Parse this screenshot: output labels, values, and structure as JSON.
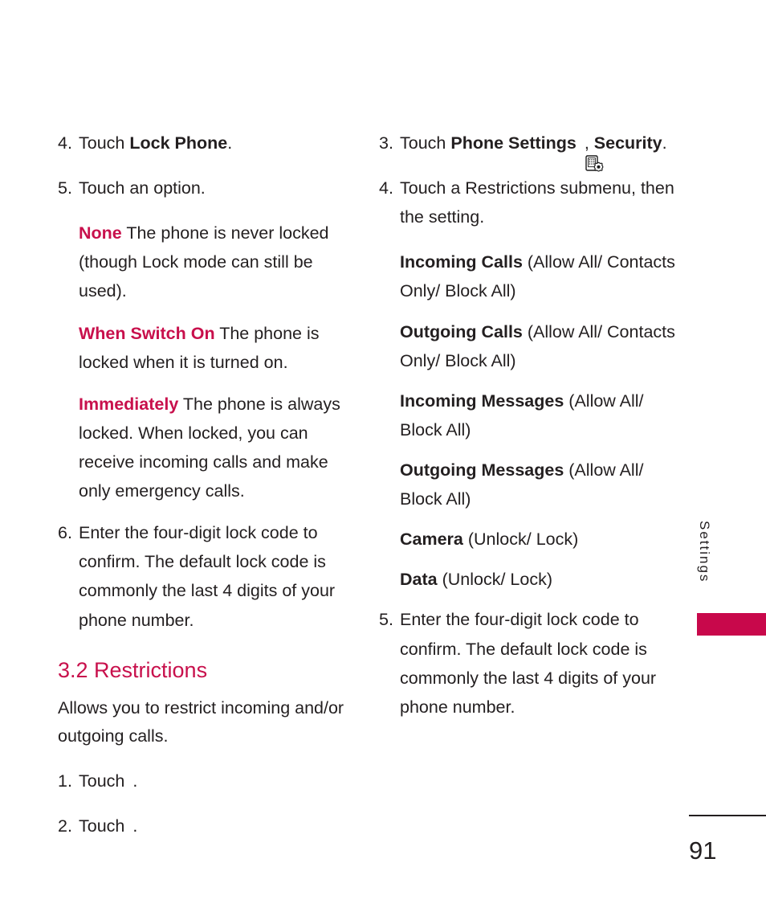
{
  "document": {
    "page_number": "91",
    "side_tab_label": "Settings",
    "accent_color": "#c8104c",
    "tab_bar_color": "#c8084b"
  },
  "left_column": {
    "step4": {
      "num": "4.",
      "prefix": "Touch ",
      "bold": "Lock Phone",
      "suffix": "."
    },
    "step5": {
      "num": "5.",
      "text": "Touch an option."
    },
    "options": [
      {
        "term": "None",
        "text": " The phone is never locked (though Lock mode can still be used)."
      },
      {
        "term": "When Switch On",
        "text": " The phone is locked when it is turned on."
      },
      {
        "term": "Immediately",
        "text": " The phone is always locked. When locked, you can receive incoming calls and make only emergency calls."
      }
    ],
    "step6": {
      "num": "6.",
      "text": "Enter the four-digit lock code to confirm. The default lock code is commonly the last 4 digits of your phone number."
    },
    "section": {
      "heading": "3.2 Restrictions",
      "intro": "Allows you to restrict incoming and/or outgoing calls."
    },
    "step1": {
      "num": "1.",
      "prefix": "Touch ",
      "icon": "grid-2x2-icon",
      "suffix": "."
    },
    "step2": {
      "num": "2.",
      "prefix": "Touch ",
      "icon": "gear-icon",
      "suffix": "."
    }
  },
  "right_column": {
    "step3": {
      "num": "3.",
      "prefix": "Touch ",
      "bold": "Phone Settings",
      "icon": "phone-settings-icon",
      "middle": ", ",
      "bold2": "Security",
      "suffix": "."
    },
    "step4": {
      "num": "4.",
      "text": "Touch a Restrictions submenu, then the setting."
    },
    "restrictions": [
      {
        "term": "Incoming Calls",
        "values": " (Allow All/ Contacts Only/ Block All)"
      },
      {
        "term": "Outgoing Calls",
        "values": " (Allow All/ Contacts Only/ Block All)"
      },
      {
        "term": "Incoming Messages",
        "values": " (Allow All/ Block All)"
      },
      {
        "term": "Outgoing Messages",
        "values": " (Allow All/ Block All)"
      },
      {
        "term": "Camera",
        "values": " (Unlock/ Lock)"
      },
      {
        "term": "Data",
        "values": " (Unlock/ Lock)"
      }
    ],
    "step5": {
      "num": "5.",
      "text": "Enter the four-digit lock code to confirm. The default lock code is commonly the last 4 digits of your phone number."
    }
  }
}
